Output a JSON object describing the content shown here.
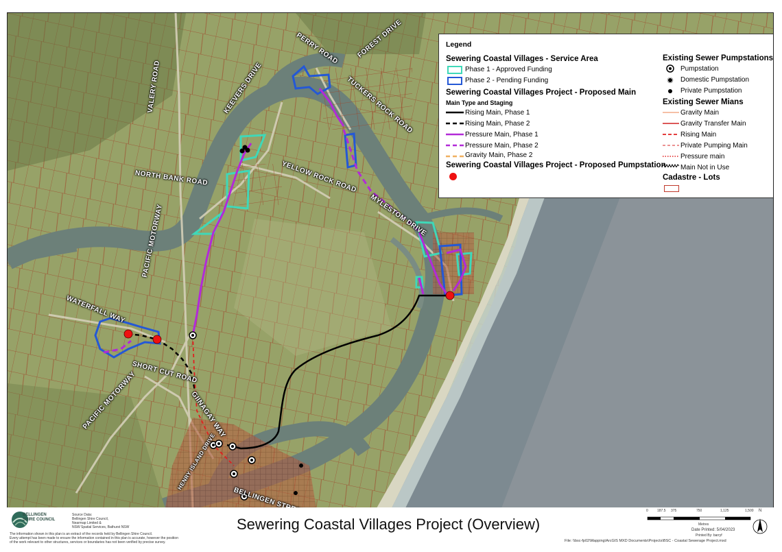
{
  "map": {
    "road_labels": {
      "perry_road": "PERRY ROAD",
      "forest_drive": "FOREST DRIVE",
      "tuckers_rock_road": "TUCKERS ROCK ROAD",
      "keevers_drive": "KEEVERS DRIVE",
      "valery_road": "VALERY ROAD",
      "north_bank_road": "NORTH BANK ROAD",
      "yellow_rock_road": "YELLOW ROCK ROAD",
      "mylestom_drive": "MYLESTOM DRIVE",
      "pacific_motorway_1": "PACIFIC MOTORWAY",
      "pacific_motorway_2": "PACIFIC MOTORWAY",
      "waterfall_way": "WATERFALL WAY",
      "short_cut_road": "SHORT CUT ROAD",
      "giinagay_way": "GIINAGAY WAY",
      "henry_island_drive": "HENRY ISLAND DRIVE",
      "bellingen_street": "BELLINGEN STREET"
    },
    "colors": {
      "land": "#9aa569",
      "river": "#6c8079",
      "ocean": "#7e8b92",
      "lot_line": "#a0462a",
      "phase1_area": "#3fd8b8",
      "phase2_area": "#2458d6",
      "pressure_main": "#b22ad8",
      "rising_main": "#000000",
      "proposed_pumpstation": "#ee1111"
    }
  },
  "legend": {
    "title": "Legend",
    "service_area_heading": "Sewering Coastal Villages - Service Area",
    "phase1": "Phase 1 - Approved Funding",
    "phase2": "Phase 2 - Pending Funding",
    "proposed_main_heading": "Sewering Coastal Villages Project - Proposed Main",
    "main_type_heading": "Main Type and Staging",
    "rising_p1": "Rising Main, Phase 1",
    "rising_p2": "Rising Main, Phase 2",
    "pressure_p1": "Pressure Main, Phase 1",
    "pressure_p2": "Pressure Main, Phase 2",
    "gravity_p2": "Gravity Main, Phase 2",
    "proposed_pump_heading": "Sewering Coastal Villages Project - Proposed Pumpstation",
    "existing_pump_heading": "Existing Sewer Pumpstations",
    "pumpstation": "Pumpstation",
    "domestic_pump": "Domestic Pumpstation",
    "private_pump": "Private Pumpstation",
    "existing_mains_heading": "Existing Sewer Mians",
    "gravity_main": "Gravity Main",
    "gravity_transfer": "Gravity Transfer Main",
    "rising_main": "Rising Main",
    "private_pumping": "Private Pumping Main",
    "pressure_main": "Pressure main",
    "main_not_in_use": "Main Not in Use",
    "cadastre_heading": "Cadastre - Lots"
  },
  "footer": {
    "title": "Sewering Coastal Villages Project (Overview)",
    "council_name_1": "BELLINGEN",
    "council_name_2": "SHIRE COUNCIL",
    "source_heading": "Source Data:",
    "source_1": "Bellingen Shire Council,",
    "source_2": "Nearmap Limited &",
    "source_3": "NSW Spatial Services, Bathurst NSW",
    "disclaimer_1": "The information shown in this plan is an extract of the records held by Bellingen Shire Council.",
    "disclaimer_2": "Every attempt has been made to ensure the information contained in this plan is accurate, however the position",
    "disclaimer_3": "of the work relevant to other structures, services or boundaries has not been verified by precise survey.",
    "scale_ticks": [
      "0",
      "187.5",
      "375",
      "750",
      "1,125",
      "1,500"
    ],
    "scale_unit": "Metres",
    "date_printed": "Date Printed: 5/04/2023",
    "printed_by": "Printed By: barryf",
    "file_path": "File: \\\\bsc-fp02\\Mapping\\ArcGIS MXD Documents\\Projects\\BSC - Coastal Sewerage Project.mxd",
    "north": "N"
  }
}
